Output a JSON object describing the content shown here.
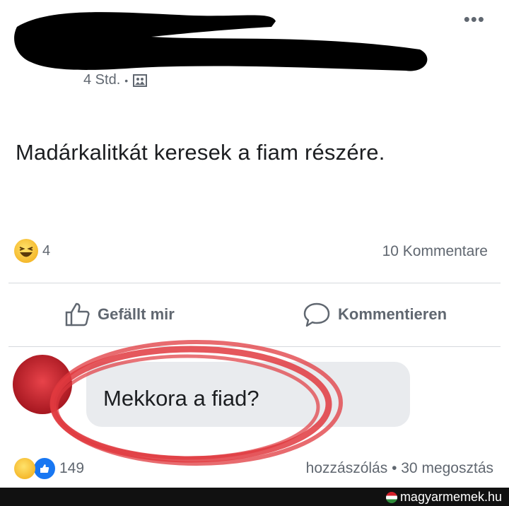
{
  "post": {
    "time": "4 Std.",
    "separator": "•",
    "text": "Madárkalitkát keresek a fiam részére.",
    "more_icon": "more-dots-icon",
    "audience_icon": "photo-audience-icon"
  },
  "reactions": {
    "count": "4",
    "comments_label": "10 Kommentare"
  },
  "actions": {
    "like_label": "Gefällt mir",
    "comment_label": "Kommentieren"
  },
  "comment": {
    "text": "Mekkora a fiad?"
  },
  "footer": {
    "reaction_count": "149",
    "right_text": "hozzászólás • 30 megosztás"
  },
  "watermark": {
    "text": "magyarmemek.hu"
  },
  "colors": {
    "secondary_text": "#606770",
    "bubble": "#e9ebee",
    "annotation_red": "#e0393f",
    "like_blue": "#1877f2"
  }
}
